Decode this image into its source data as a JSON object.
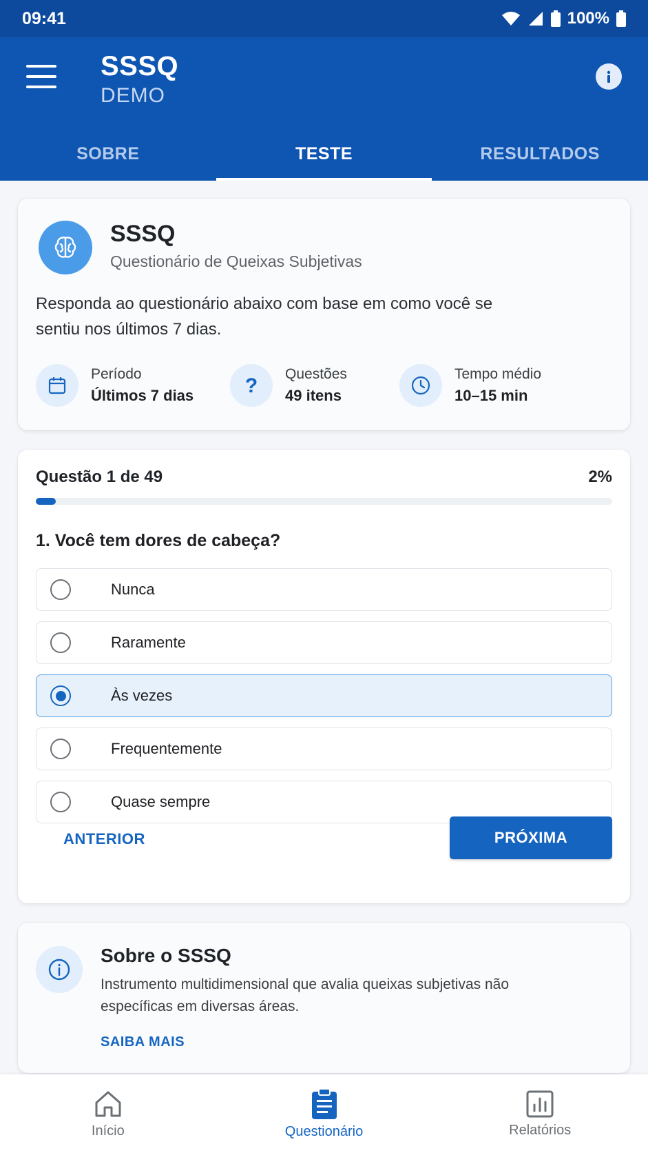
{
  "status_bar": {
    "time": "09:41",
    "battery": "100%"
  },
  "app_bar": {
    "title": "SSSQ",
    "subtitle": "DEMO",
    "tabs": [
      {
        "label": "SOBRE",
        "active": false
      },
      {
        "label": "TESTE",
        "active": true
      },
      {
        "label": "RESULTADOS",
        "active": false
      }
    ]
  },
  "intro": {
    "title": "SSSQ",
    "subtitle": "Questionário de Queixas Subjetivas",
    "description": "Responda ao questionário abaixo com base em como você se sentiu nos últimos 7 dias.",
    "stats": [
      {
        "icon": "calendar-icon",
        "label": "Período",
        "value": "Últimos 7 dias"
      },
      {
        "icon": "question-icon",
        "label": "Questões",
        "value": "49 itens"
      },
      {
        "icon": "clock-icon",
        "label": "Tempo médio",
        "value": "10–15 min"
      }
    ]
  },
  "question": {
    "counter": "Questão 1 de 49",
    "percent_label": "2%",
    "progress": 0.02,
    "text": "1. Você tem dores de cabeça?",
    "options": [
      {
        "label": "Nunca",
        "selected": false
      },
      {
        "label": "Raramente",
        "selected": false
      },
      {
        "label": "Às vezes",
        "selected": true
      },
      {
        "label": "Frequentemente",
        "selected": false
      },
      {
        "label": "Quase sempre",
        "selected": false
      }
    ],
    "prev_label": "ANTERIOR",
    "next_label": "PRÓXIMA"
  },
  "about": {
    "title": "Sobre o SSSQ",
    "description": "Instrumento multidimensional que avalia queixas subjetivas não específicas em diversas áreas.",
    "link_label": "SAIBA MAIS"
  },
  "bottom_nav": [
    {
      "label": "Início",
      "icon": "home-icon",
      "active": false
    },
    {
      "label": "Questionário",
      "icon": "clipboard-icon",
      "active": true
    },
    {
      "label": "Relatórios",
      "icon": "bar-chart-icon",
      "active": false
    }
  ],
  "colors": {
    "primary": "#1565c0",
    "app_bar": "#0f56b3",
    "status_bar": "#0d4a9e",
    "selected_bg": "#e7f1fb"
  }
}
